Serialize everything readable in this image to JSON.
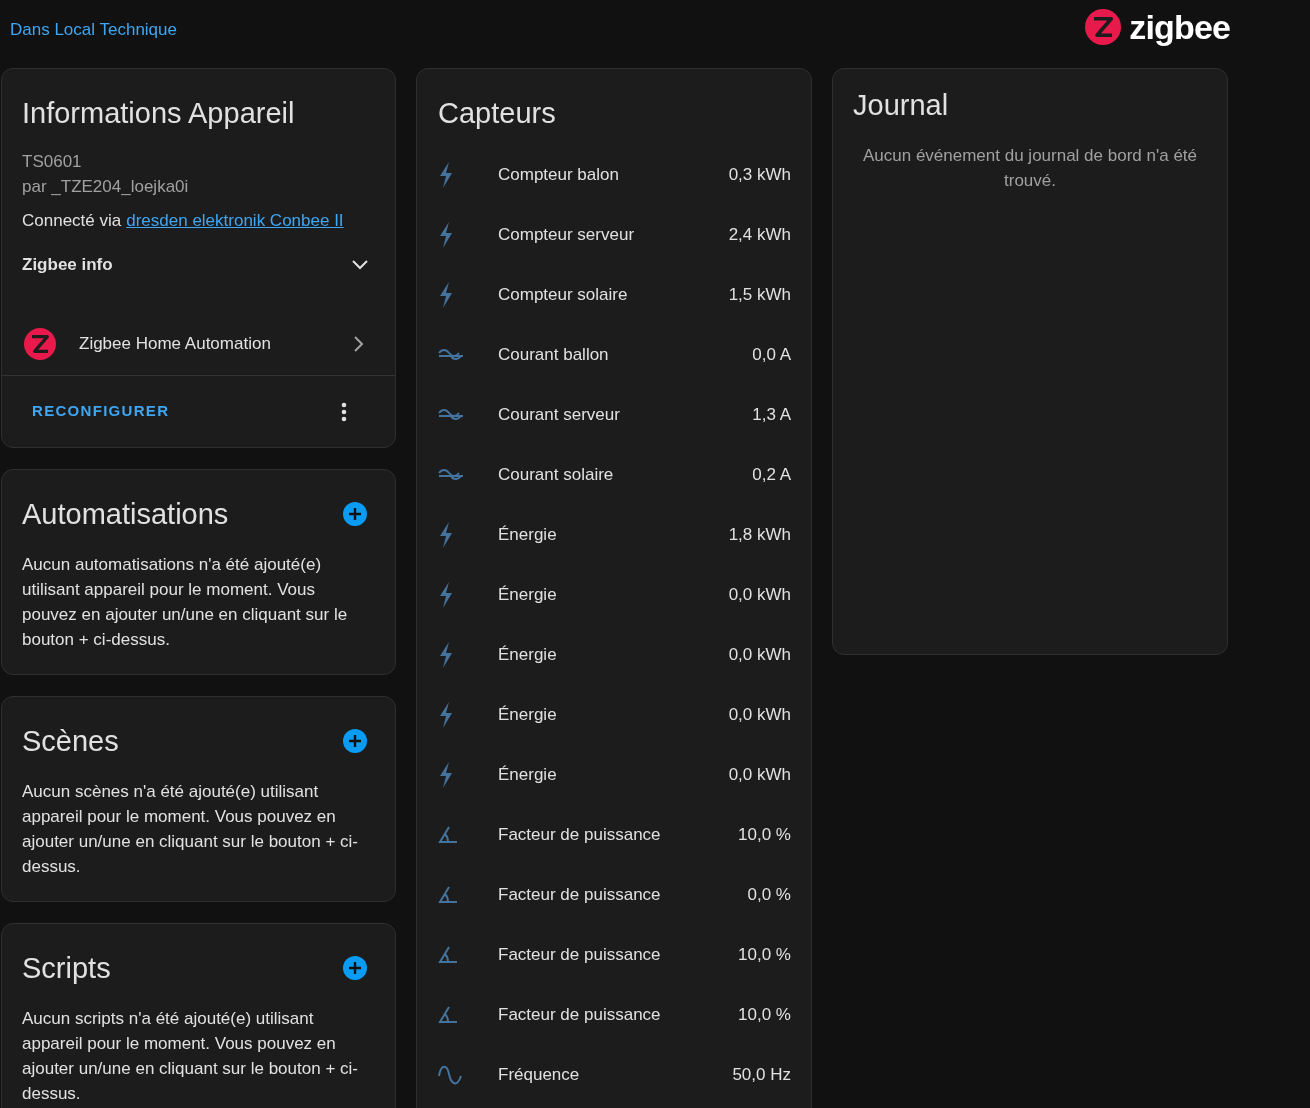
{
  "header": {
    "area": "Dans Local Technique",
    "logo_text": "zigbee"
  },
  "device_info": {
    "title": "Informations Appareil",
    "model": "TS0601",
    "manufacturer": "par _TZE204_loejka0i",
    "connected_label": "Connecté via",
    "connected_link": "dresden elektronik Conbee II",
    "zigbee_info": {
      "label": "Zigbee info",
      "expanded": false
    },
    "integration": "Zigbee Home Automation",
    "action": "RECONFIGURER"
  },
  "related": [
    {
      "title": "Automatisations",
      "text": "Aucun automatisations n'a été ajouté(e) utilisant appareil pour le moment. Vous pouvez en ajouter un/une en cliquant sur le bouton + ci-dessus."
    },
    {
      "title": "Scènes",
      "text": "Aucun scènes n'a été ajouté(e) utilisant appareil pour le moment. Vous pouvez en ajouter un/une en cliquant sur le bouton + ci-dessus."
    },
    {
      "title": "Scripts",
      "text": "Aucun scripts n'a été ajouté(e) utilisant appareil pour le moment. Vous pouvez en ajouter un/une en cliquant sur le bouton + ci-dessus."
    }
  ],
  "sensors": {
    "title": "Capteurs",
    "items": [
      {
        "kind": "energy",
        "name": "Compteur balon",
        "value": "0,3 kWh"
      },
      {
        "kind": "energy",
        "name": "Compteur serveur",
        "value": "2,4 kWh"
      },
      {
        "kind": "energy",
        "name": "Compteur solaire",
        "value": "1,5 kWh"
      },
      {
        "kind": "current",
        "name": "Courant ballon",
        "value": "0,0 A"
      },
      {
        "kind": "current",
        "name": "Courant serveur",
        "value": "1,3 A"
      },
      {
        "kind": "current",
        "name": "Courant solaire",
        "value": "0,2 A"
      },
      {
        "kind": "energy",
        "name": "Énergie",
        "value": "1,8 kWh"
      },
      {
        "kind": "energy",
        "name": "Énergie",
        "value": "0,0 kWh"
      },
      {
        "kind": "energy",
        "name": "Énergie",
        "value": "0,0 kWh"
      },
      {
        "kind": "energy",
        "name": "Énergie",
        "value": "0,0 kWh"
      },
      {
        "kind": "energy",
        "name": "Énergie",
        "value": "0,0 kWh"
      },
      {
        "kind": "power_factor",
        "name": "Facteur de puissance",
        "value": "10,0 %"
      },
      {
        "kind": "power_factor",
        "name": "Facteur de puissance",
        "value": "0,0 %"
      },
      {
        "kind": "power_factor",
        "name": "Facteur de puissance",
        "value": "10,0 %"
      },
      {
        "kind": "power_factor",
        "name": "Facteur de puissance",
        "value": "10,0 %"
      },
      {
        "kind": "frequency",
        "name": "Fréquence",
        "value": "50,0 Hz"
      }
    ]
  },
  "logbook": {
    "title": "Journal",
    "empty_text": "Aucun événement du journal de bord n'a été trouvé."
  }
}
